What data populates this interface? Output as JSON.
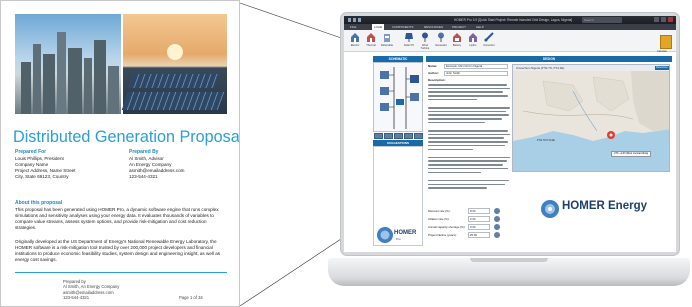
{
  "proposal": {
    "title": "Distributed Generation Proposal",
    "prepared_for": {
      "heading": "Prepared For",
      "lines": [
        "Louis Phillips, President",
        "Company Name",
        "Project Address, Name Street",
        "City, State 69123, Country"
      ]
    },
    "prepared_by": {
      "heading": "Prepared By",
      "lines": [
        "Al Smith, Advisor",
        "An Energy Company",
        "asmith@emailaddress.com",
        "123-544-4321"
      ]
    },
    "about_heading": "About this proposal",
    "about_paragraph_1": "This proposal has been generated using HOMER Pro, a dynamic software engine that runs complex simulations and sensitivity analyses using your energy data. It evaluates thousands of variables to compare value streams, assess system options, and provide risk-mitigation and cost reduction strategies.",
    "about_paragraph_2": "Originally developed at the US Department of Energy's National Renewable Energy Laboratory, the HOMER software is a risk-mitigation tool trusted by over 200,000 project developers and financial institutions to produce economic feasibility studies, system design and engineering insight, as well as energy cost savings.",
    "footer": {
      "prepared_by_label": "Prepared by",
      "lines": [
        "Al Smith, An Energy Company",
        "asmith@emailaddress.com",
        "123-544-4321"
      ],
      "page": "Page 1 of 34"
    }
  },
  "app": {
    "window_title": "HOMER Pro 3.9 [Quick Start Project: Remote Islanded Grid Design, Lagos, Nigeria]",
    "search_placeholder": "Search",
    "menu": [
      "FILE",
      "LOAD",
      "COMPONENTS",
      "RESOURCES",
      "PROJECT",
      "HELP"
    ],
    "active_menu": "LOAD",
    "ribbon_buttons": [
      "Electric",
      "Thermal",
      "Deferrable",
      "Solar PV",
      "Wind Turbine",
      "Generator",
      "Battery",
      "Hydro",
      "Converter",
      "Calculate"
    ],
    "schematic_heading": "SCHEMATIC",
    "suggestions_heading": "SUGGESTIONS",
    "design_heading": "DESIGN",
    "form": {
      "name_label": "Name:",
      "name_value": "Example: Mini Grid in Nigeria",
      "author_label": "Author:",
      "author_value": "John Smith",
      "description_label": "Description:"
    },
    "economic_rows": [
      {
        "label": "Discount rate (%):",
        "value": "8.00"
      },
      {
        "label": "Inflation rate (%):",
        "value": "2.00"
      },
      {
        "label": "Annual capacity shortage (%):",
        "value": "0.00"
      },
      {
        "label": "Project lifetime (years):",
        "value": "25.00"
      }
    ],
    "map": {
      "location_label": "Umuechem Nigeria (4°54.7N, 6°10.4E)",
      "resources_button": "Resources",
      "coordinates": "4°54.7N 6°10.4E",
      "callout": "UTC +1:00 (West Central Africa)"
    },
    "brand_small": "HOMER",
    "brand_small_sub": "Pro",
    "brand_large": "HOMER Energy",
    "calculate_label": "Calculate"
  },
  "colors": {
    "title_blue": "#2a9fd6",
    "header_blue": "#1b6aa8",
    "brand_navy": "#1d3f6e"
  }
}
